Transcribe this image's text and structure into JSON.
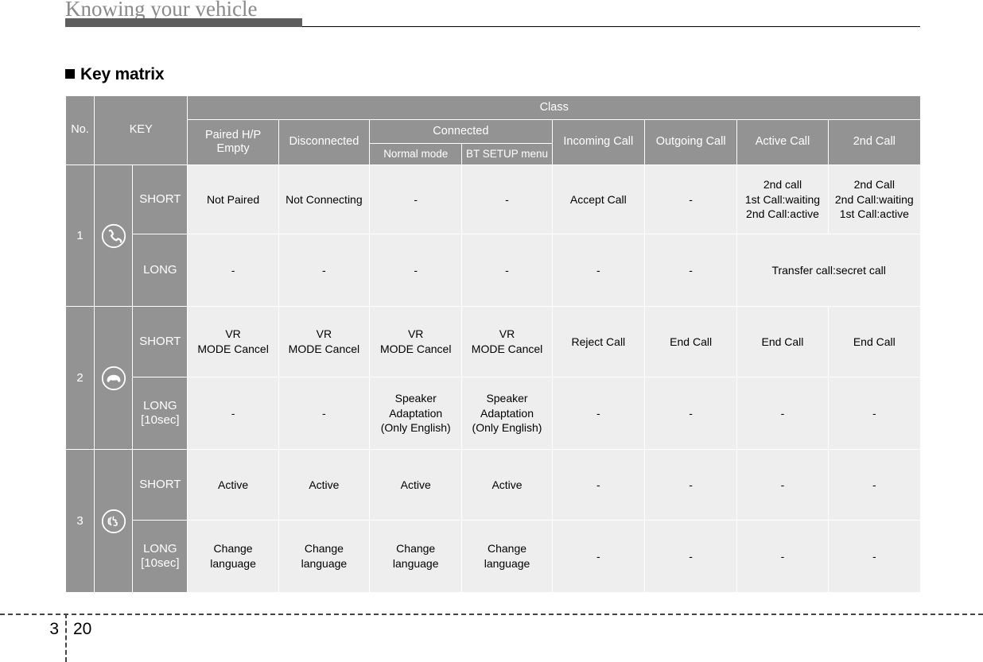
{
  "page": {
    "running_head": "Knowing your vehicle",
    "section_heading": "Key matrix",
    "chapter_number": "3",
    "page_number": "20",
    "accent_gray": "#939393",
    "cell_gray": "#eeeeee",
    "head_bar_gray": "#5e5e5e",
    "head_title_gray": "#8a8a8a"
  },
  "table": {
    "headers": {
      "no": "No.",
      "key": "KEY",
      "class": "Class",
      "paired_hp_empty": "Paired H/P\nEmpty",
      "paired_hp_line1": "Paired H/P",
      "paired_hp_line2": "Empty",
      "disconnected": "Disconnected",
      "connected": "Connected",
      "normal_mode": "Normal mode",
      "bt_setup_menu": "BT SETUP menu",
      "incoming_call": "Incoming Call",
      "outgoing_call": "Outgoing Call",
      "active_call": "Active Call",
      "second_call": "2nd Call"
    },
    "rows": [
      {
        "no": "1",
        "icon": "call-phone-icon",
        "modes": [
          {
            "label": "SHORT",
            "label_line1": "SHORT",
            "label_line2": "",
            "cells": {
              "paired": "Not Paired",
              "disconnected": "Not Connecting",
              "normal_mode": "-",
              "bt_setup": "-",
              "incoming": "Accept Call",
              "outgoing": "-",
              "active": "2nd call\n1st Call:waiting\n2nd Call:active",
              "active_l1": "2nd call",
              "active_l2": "1st Call:waiting",
              "active_l3": "2nd Call:active",
              "second": "2nd Call\n2nd Call:waiting\n1st Call:active",
              "second_l1": "2nd Call",
              "second_l2": "2nd Call:waiting",
              "second_l3": "1st Call:active"
            }
          },
          {
            "label": "LONG",
            "label_line1": "LONG",
            "label_line2": "",
            "cells": {
              "paired": "-",
              "disconnected": "-",
              "normal_mode": "-",
              "bt_setup": "-",
              "incoming": "-",
              "outgoing": "-",
              "active_second_merged": "Transfer call:secret call"
            }
          }
        ]
      },
      {
        "no": "2",
        "icon": "end-call-icon",
        "modes": [
          {
            "label": "SHORT",
            "label_line1": "SHORT",
            "label_line2": "",
            "cells": {
              "paired": "VR\nMODE Cancel",
              "paired_l1": "VR",
              "paired_l2": "MODE Cancel",
              "disconnected_l1": "VR",
              "disconnected_l2": "MODE Cancel",
              "normal_l1": "VR",
              "normal_l2": "MODE Cancel",
              "bt_l1": "VR",
              "bt_l2": "MODE Cancel",
              "incoming": "Reject Call",
              "outgoing": "End Call",
              "active": "End Call",
              "second": "End Call"
            }
          },
          {
            "label": "LONG [10sec]",
            "label_line1": "LONG",
            "label_line2": "[10sec]",
            "cells": {
              "paired": "-",
              "disconnected": "-",
              "normal_l1": "Speaker",
              "normal_l2": "Adaptation",
              "normal_l3": "(Only English)",
              "bt_l1": "Speaker",
              "bt_l2": "Adaptation",
              "bt_l3": "(Only English)",
              "incoming": "-",
              "outgoing": "-",
              "active": "-",
              "second": "-"
            }
          }
        ]
      },
      {
        "no": "3",
        "icon": "voice-recognition-icon",
        "modes": [
          {
            "label": "SHORT",
            "label_line1": "SHORT",
            "label_line2": "",
            "cells": {
              "paired": "Active",
              "disconnected": "Active",
              "normal_mode": "Active",
              "bt_setup": "Active",
              "incoming": "-",
              "outgoing": "-",
              "active": "-",
              "second": "-"
            }
          },
          {
            "label": "LONG [10sec]",
            "label_line1": "LONG",
            "label_line2": "[10sec]",
            "cells": {
              "paired_l1": "Change",
              "paired_l2": "language",
              "disconnected_l1": "Change",
              "disconnected_l2": "language",
              "normal_l1": "Change",
              "normal_l2": "language",
              "bt_l1": "Change",
              "bt_l2": "language",
              "incoming": "-",
              "outgoing": "-",
              "active": "-",
              "second": "-"
            }
          }
        ]
      }
    ]
  }
}
